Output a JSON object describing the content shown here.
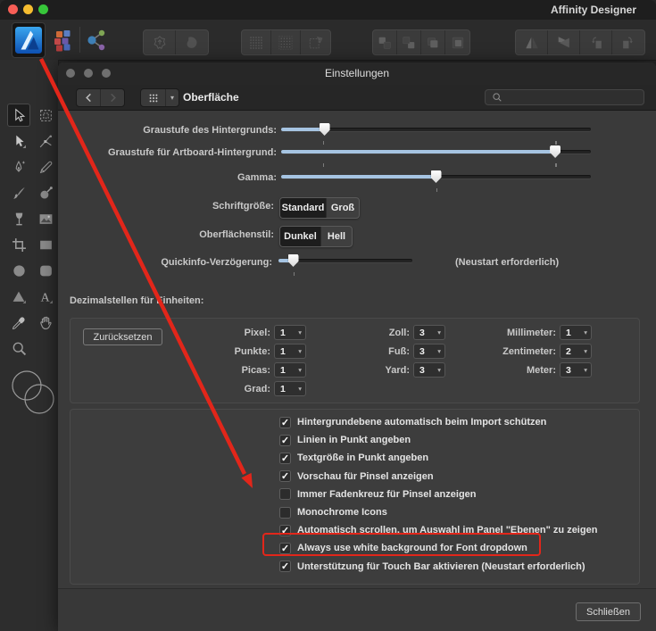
{
  "window": {
    "title": "Affinity Designer"
  },
  "main_toolbar": {
    "personas": [
      {
        "icon": "affinity-designer-logo",
        "selected": true
      },
      {
        "icon": "pixel-persona-icon",
        "selected": false
      },
      {
        "icon": "export-persona-icon",
        "selected": false
      }
    ],
    "groups": [
      {
        "buttons": [
          {
            "icon": "insert-inside-icon"
          },
          {
            "icon": "insert-behind-icon"
          }
        ]
      },
      {
        "buttons": [
          {
            "icon": "pixel-grid-icon"
          },
          {
            "icon": "pixel-grid-fine-icon"
          },
          {
            "icon": "snap-bounds-icon"
          }
        ]
      },
      {
        "buttons": [
          {
            "icon": "order-back-icon"
          },
          {
            "icon": "order-backward-icon"
          },
          {
            "icon": "order-forward-icon"
          },
          {
            "icon": "order-front-icon"
          }
        ]
      },
      {
        "buttons": [
          {
            "icon": "flip-horizontal-icon"
          },
          {
            "icon": "flip-vertical-icon"
          },
          {
            "icon": "rotate-ccw-icon"
          },
          {
            "icon": "rotate-cw-icon"
          }
        ]
      }
    ]
  },
  "sidebar": {
    "tools": [
      {
        "icon": "move-tool",
        "selected": true
      },
      {
        "icon": "artboard-tool",
        "selected": false
      },
      {
        "icon": "node-tool",
        "selected": false
      },
      {
        "icon": "point-transform-tool",
        "selected": false
      },
      {
        "icon": "pen-tool",
        "selected": false
      },
      {
        "icon": "pencil-tool",
        "selected": false
      },
      {
        "icon": "vector-brush-tool",
        "selected": false
      },
      {
        "icon": "fill-tool",
        "selected": false
      },
      {
        "icon": "transparency-tool",
        "selected": false
      },
      {
        "icon": "place-image-tool",
        "selected": false
      },
      {
        "icon": "crop-tool",
        "selected": false
      },
      {
        "icon": "rectangle-tool",
        "selected": false
      },
      {
        "icon": "ellipse-tool",
        "selected": false
      },
      {
        "icon": "rounded-rectangle-tool",
        "selected": false
      },
      {
        "icon": "triangle-tool",
        "selected": false
      },
      {
        "icon": "artistic-text-tool",
        "selected": false
      },
      {
        "icon": "color-picker-tool",
        "selected": false
      },
      {
        "icon": "view-tool",
        "selected": false
      },
      {
        "icon": "zoom-tool",
        "selected": false
      }
    ]
  },
  "dialog": {
    "title": "Einstellungen",
    "section_title": "Oberfläche",
    "search": {
      "placeholder": ""
    },
    "sliders": [
      {
        "label": "Graustufe des Hintergrunds:",
        "value_pct": 14,
        "ticks_pct": [
          13.5,
          88.5
        ]
      },
      {
        "label": "Graustufe für Artboard-Hintergrund:",
        "value_pct": 88.5,
        "ticks_pct": [
          13.5,
          88.5
        ]
      },
      {
        "label": "Gamma:",
        "value_pct": 50,
        "ticks_pct": [
          50
        ]
      }
    ],
    "font_size": {
      "label": "Schriftgröße:",
      "options": [
        "Standard",
        "Groß"
      ],
      "selected": "Standard"
    },
    "ui_style": {
      "label": "Oberflächenstil:",
      "options": [
        "Dunkel",
        "Hell"
      ],
      "selected": "Dunkel"
    },
    "tooltip_delay": {
      "label": "Quickinfo-Verzögerung:",
      "value_pct": 11,
      "ticks_pct": [
        11
      ],
      "note": "(Neustart erforderlich)"
    },
    "decimals": {
      "title": "Dezimalstellen für Einheiten:",
      "reset_label": "Zurücksetzen",
      "columns": [
        [
          {
            "label": "Pixel:",
            "value": "1"
          },
          {
            "label": "Punkte:",
            "value": "1"
          },
          {
            "label": "Picas:",
            "value": "1"
          },
          {
            "label": "Grad:",
            "value": "1"
          }
        ],
        [
          {
            "label": "Zoll:",
            "value": "3"
          },
          {
            "label": "Fuß:",
            "value": "3"
          },
          {
            "label": "Yard:",
            "value": "3"
          }
        ],
        [
          {
            "label": "Millimeter:",
            "value": "1"
          },
          {
            "label": "Zentimeter:",
            "value": "2"
          },
          {
            "label": "Meter:",
            "value": "3"
          }
        ]
      ]
    },
    "checkboxes": [
      {
        "label": "Hintergrundebene automatisch beim Import schützen",
        "checked": true
      },
      {
        "label": "Linien in Punkt angeben",
        "checked": true
      },
      {
        "label": "Textgröße in Punkt angeben",
        "checked": true
      },
      {
        "label": "Vorschau für Pinsel anzeigen",
        "checked": true
      },
      {
        "label": "Immer Fadenkreuz für Pinsel anzeigen",
        "checked": false
      },
      {
        "label": "Monochrome Icons",
        "checked": false
      },
      {
        "label": "Automatisch scrollen, um Auswahl im Panel \"Ebenen\" zu zeigen",
        "checked": true
      },
      {
        "label": "Always use white background for Font dropdown",
        "checked": true,
        "highlighted": true
      },
      {
        "label": "Unterstützung für Touch Bar aktivieren (Neustart erforderlich)",
        "checked": true
      }
    ],
    "close_label": "Schließen"
  },
  "annotation": {
    "arrow_color": "#e2261a",
    "highlight_color": "#e2261a"
  }
}
